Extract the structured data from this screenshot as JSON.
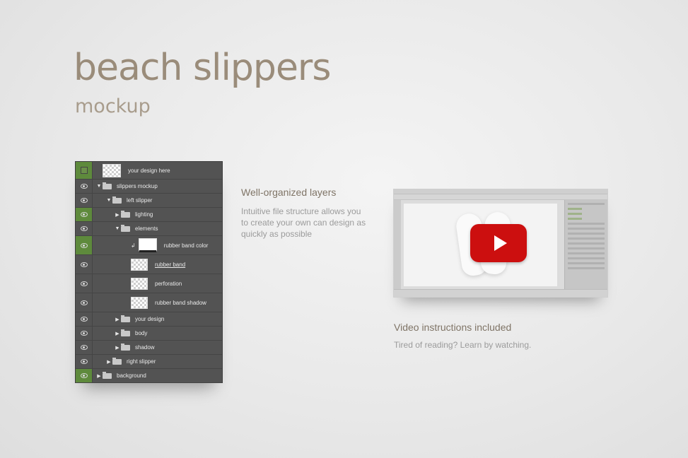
{
  "header": {
    "title": "beach slippers",
    "subtitle": "mockup"
  },
  "layers": [
    {
      "name": "your design here",
      "indent": 0,
      "arrow": "",
      "icon": "smart-object",
      "visibility": "square",
      "highlight": true,
      "height": "top"
    },
    {
      "name": "slippers mockup",
      "indent": 0,
      "arrow": "▼",
      "icon": "folder-open",
      "visibility": "eye"
    },
    {
      "name": "left slipper",
      "indent": 1,
      "arrow": "▼",
      "icon": "folder-open",
      "visibility": "eye"
    },
    {
      "name": "lighting",
      "indent": 2,
      "arrow": "▶",
      "icon": "folder",
      "visibility": "eye",
      "highlight": true
    },
    {
      "name": "elements",
      "indent": 2,
      "arrow": "▼",
      "icon": "folder-open",
      "visibility": "eye"
    },
    {
      "name": "rubber band color",
      "indent": 3,
      "arrow": "",
      "icon": "white-thumb",
      "visibility": "eye",
      "highlight": true,
      "height": "tall",
      "link": "↲"
    },
    {
      "name": "rubber band",
      "indent": 3,
      "arrow": "",
      "icon": "checker-thumb",
      "visibility": "eye",
      "height": "tall",
      "underline": true
    },
    {
      "name": "perforation",
      "indent": 3,
      "arrow": "",
      "icon": "checker-thumb",
      "visibility": "eye",
      "height": "tall"
    },
    {
      "name": "rubber band shadow",
      "indent": 3,
      "arrow": "",
      "icon": "checker-thumb",
      "visibility": "eye",
      "height": "tall"
    },
    {
      "name": "your design",
      "indent": 2,
      "arrow": "▶",
      "icon": "folder",
      "visibility": "eye"
    },
    {
      "name": "body",
      "indent": 2,
      "arrow": "▶",
      "icon": "folder",
      "visibility": "eye"
    },
    {
      "name": "shadow",
      "indent": 2,
      "arrow": "▶",
      "icon": "folder",
      "visibility": "eye"
    },
    {
      "name": "right slipper",
      "indent": 1,
      "arrow": "▶",
      "icon": "folder",
      "visibility": "eye"
    },
    {
      "name": "background",
      "indent": 0,
      "arrow": "▶",
      "icon": "folder",
      "visibility": "eye",
      "highlight": true
    }
  ],
  "features": {
    "layers": {
      "title": "Well-organized layers",
      "text": "Intuitive file structure allows you to create your own can design as quickly as possible"
    },
    "video": {
      "title": "Video instructions included",
      "text": "Tired of reading? Learn by watching."
    }
  },
  "colors": {
    "title": "#9a8c7a",
    "panel": "#535353",
    "visibility_green": "#5e8a3c",
    "play_button": "#cc0f0f"
  },
  "icons": {
    "play": "play-triangle-icon",
    "eye": "eye-icon",
    "folder": "folder-icon"
  }
}
